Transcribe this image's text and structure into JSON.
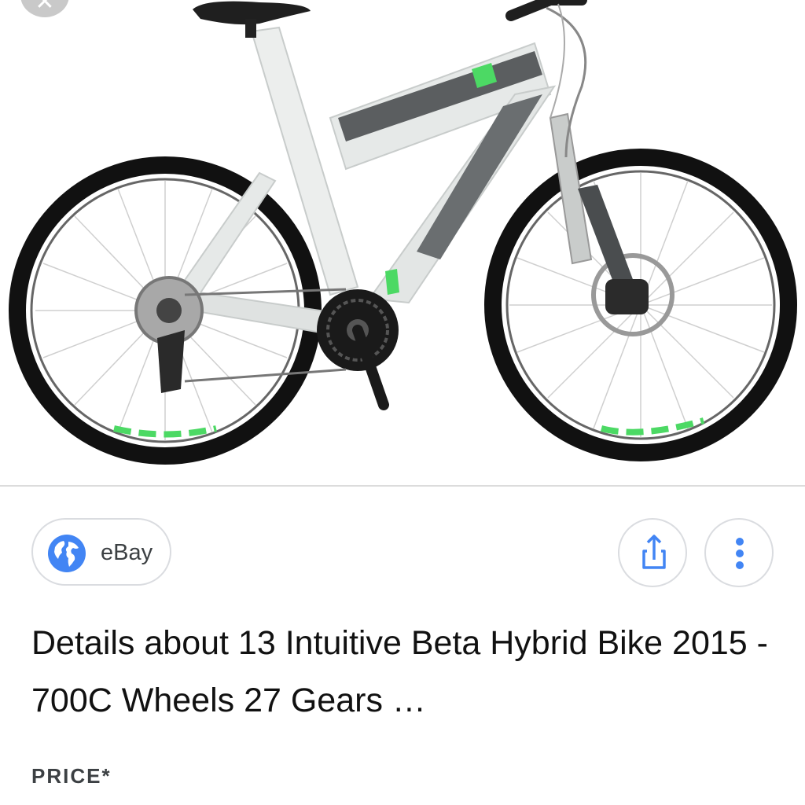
{
  "image": {
    "subject": "bicycle-image"
  },
  "source": {
    "name": "eBay",
    "icon": "globe-icon"
  },
  "actions": {
    "share_icon": "share-icon",
    "more_icon": "more-vert-icon"
  },
  "product": {
    "title": "Details about 13 Intuitive Beta Hybrid Bike 2015 - 700C Wheels 27 Gears …"
  },
  "price": {
    "label": "PRICE*"
  },
  "colors": {
    "accent": "#4285f4",
    "frame": "#e6e9e8",
    "frame_stripe": "#5b5e60",
    "brand_green": "#4cd964"
  }
}
